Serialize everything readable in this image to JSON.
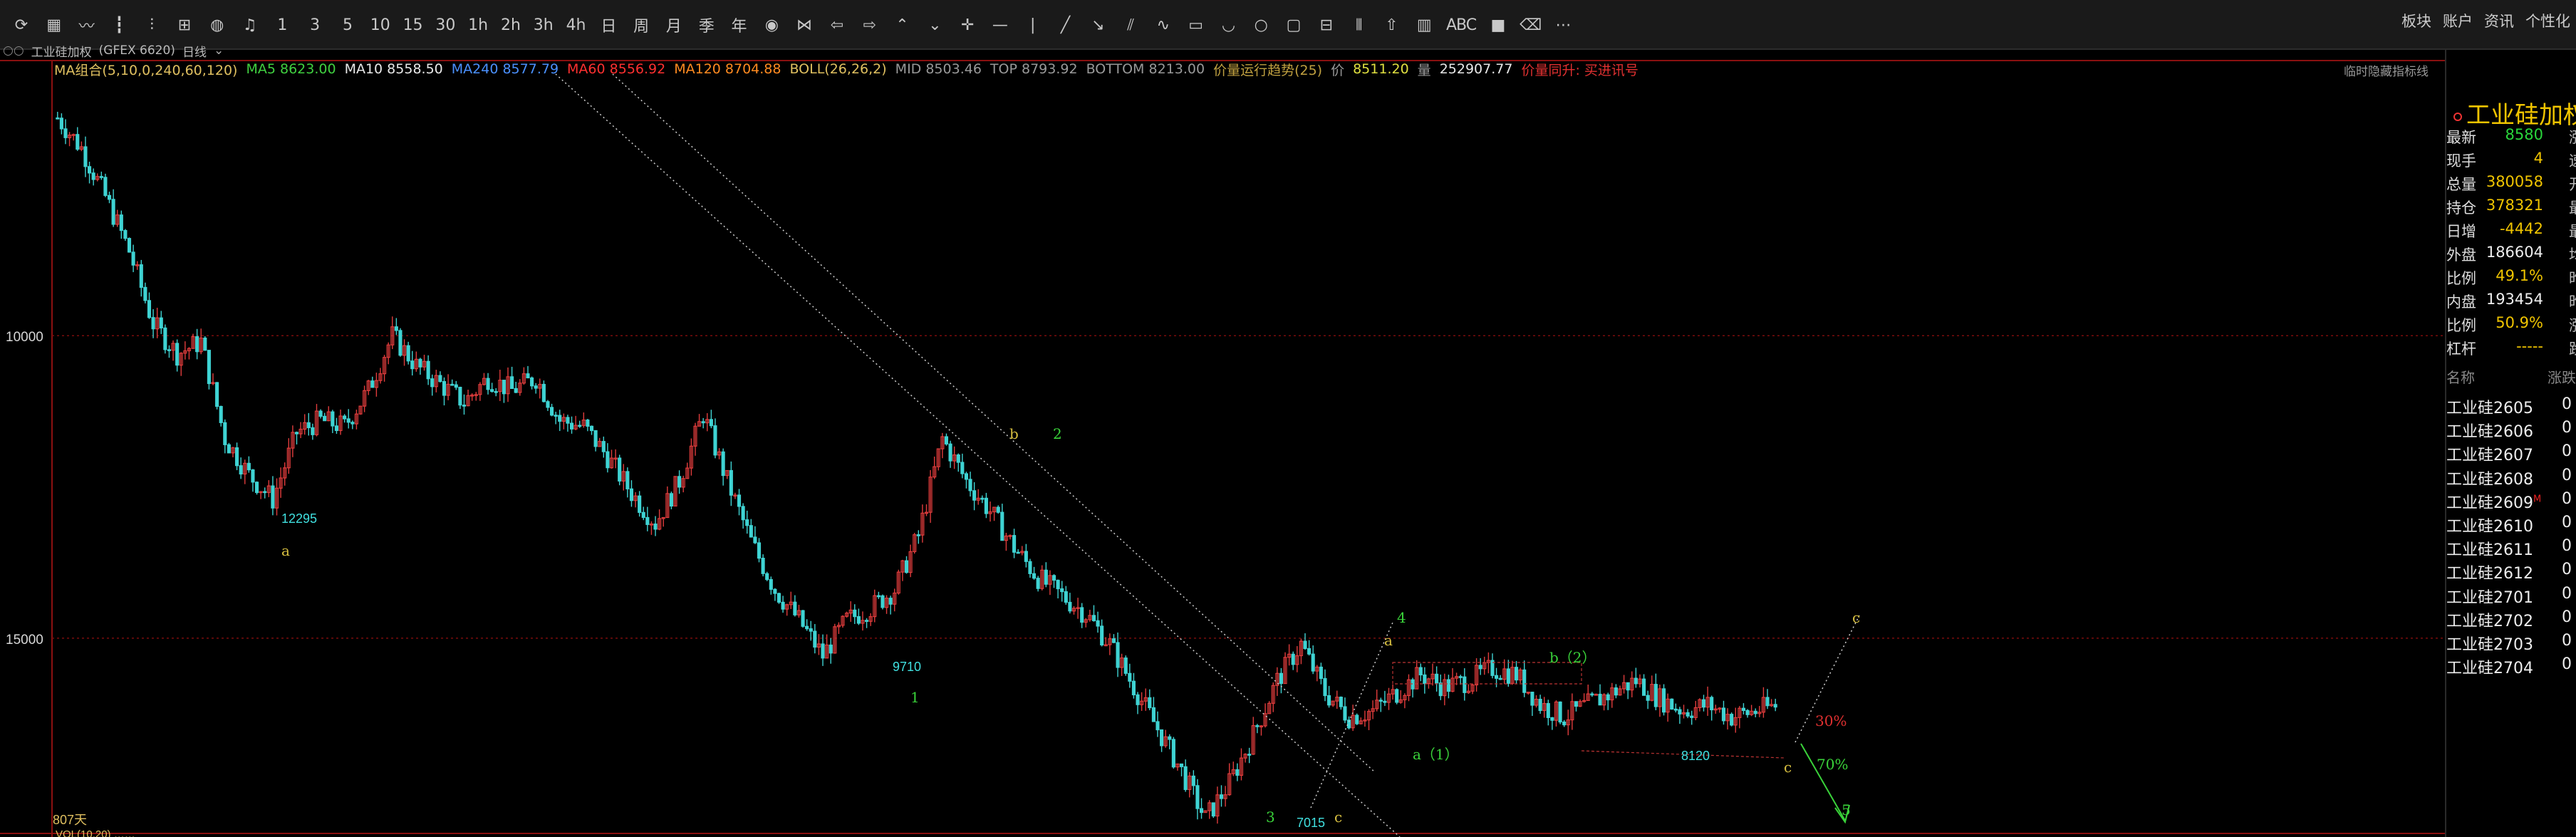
{
  "toolbar": {
    "tools": [
      {
        "name": "refresh-icon",
        "glyph": "⟳"
      },
      {
        "name": "table-icon",
        "glyph": "▦"
      },
      {
        "name": "line-chart-icon",
        "glyph": "〰"
      },
      {
        "name": "candlestick-icon",
        "glyph": "┇"
      },
      {
        "name": "bars-icon",
        "glyph": "⫶"
      },
      {
        "name": "grid-icon",
        "glyph": "⊞"
      },
      {
        "name": "globe-icon",
        "glyph": "◍"
      },
      {
        "name": "bell-icon",
        "glyph": "♫"
      },
      {
        "name": "period-1",
        "glyph": "1"
      },
      {
        "name": "period-3",
        "glyph": "3"
      },
      {
        "name": "period-5",
        "glyph": "5"
      },
      {
        "name": "period-10",
        "glyph": "10"
      },
      {
        "name": "period-15",
        "glyph": "15"
      },
      {
        "name": "period-30",
        "glyph": "30"
      },
      {
        "name": "period-1h",
        "glyph": "1h"
      },
      {
        "name": "period-2h",
        "glyph": "2h"
      },
      {
        "name": "period-3h",
        "glyph": "3h"
      },
      {
        "name": "period-4h",
        "glyph": "4h"
      },
      {
        "name": "period-day",
        "glyph": "日"
      },
      {
        "name": "period-week",
        "glyph": "周"
      },
      {
        "name": "period-month",
        "glyph": "月"
      },
      {
        "name": "period-season",
        "glyph": "季"
      },
      {
        "name": "period-year",
        "glyph": "年"
      },
      {
        "name": "eye-icon",
        "glyph": "◉"
      },
      {
        "name": "bowtie-icon",
        "glyph": "⋈"
      },
      {
        "name": "arrow-left-icon",
        "glyph": "⇦"
      },
      {
        "name": "arrow-right-icon",
        "glyph": "⇨"
      },
      {
        "name": "chevrons-up-icon",
        "glyph": "⌃"
      },
      {
        "name": "chevrons-down-icon",
        "glyph": "⌄"
      },
      {
        "name": "crosshair-icon",
        "glyph": "✛"
      },
      {
        "name": "horizontal-line-icon",
        "glyph": "—"
      },
      {
        "name": "vertical-line-icon",
        "glyph": "|"
      },
      {
        "name": "trend-line-icon",
        "glyph": "╱"
      },
      {
        "name": "ray-icon",
        "glyph": "↘"
      },
      {
        "name": "parallel-line-icon",
        "glyph": "⫽"
      },
      {
        "name": "wave-icon",
        "glyph": "∿"
      },
      {
        "name": "rectangle-icon",
        "glyph": "▭"
      },
      {
        "name": "arc-icon",
        "glyph": "◡"
      },
      {
        "name": "circle-icon",
        "glyph": "○"
      },
      {
        "name": "square-icon",
        "glyph": "▢"
      },
      {
        "name": "fibonacci-icon",
        "glyph": "⊟"
      },
      {
        "name": "columns-icon",
        "glyph": "⦀"
      },
      {
        "name": "up-arrow-icon",
        "glyph": "⇧"
      },
      {
        "name": "bar-chart-icon",
        "glyph": "▥"
      },
      {
        "name": "text-tool",
        "glyph": "ABC"
      },
      {
        "name": "fill-icon",
        "glyph": "■"
      },
      {
        "name": "eraser-icon",
        "glyph": "⌫"
      },
      {
        "name": "more-icon",
        "glyph": "⋯"
      }
    ],
    "menu": [
      "板块",
      "账户",
      "资讯",
      "个性化"
    ]
  },
  "symbol_bar": {
    "prefix": "○○",
    "symbol": "工业硅加权",
    "exchange": "(GFEX 6620)",
    "period": "日线"
  },
  "ma_line": [
    {
      "text": "MA组合(5,10,0,240,60,120)",
      "color": "#e0c060"
    },
    {
      "text": "MA5 8623.00",
      "color": "#40d040"
    },
    {
      "text": "MA10 8558.50",
      "color": "#e8e8e8"
    },
    {
      "text": "MA240 8577.79",
      "color": "#4a90ff"
    },
    {
      "text": "MA60 8556.92",
      "color": "#ff3030"
    },
    {
      "text": "MA120 8704.88",
      "color": "#ff8a20"
    },
    {
      "text": "BOLL(26,26,2)",
      "color": "#e0c060"
    },
    {
      "text": "MID 8503.46",
      "color": "#999999"
    },
    {
      "text": "TOP 8793.92",
      "color": "#999999"
    },
    {
      "text": "BOTTOM 8213.00",
      "color": "#999999"
    },
    {
      "text": "价量运行趋势(25)",
      "color": "#c0a040"
    },
    {
      "text": "价",
      "color": "#999999"
    },
    {
      "text": "8511.20",
      "color": "#e0e040"
    },
    {
      "text": "量",
      "color": "#999999"
    },
    {
      "text": "252907.77",
      "color": "#e8e8e8"
    },
    {
      "text": "价量同升: 买进讯号",
      "color": "#e03030"
    }
  ],
  "right_note": "临时隐藏指标线",
  "chart": {
    "price_labels": [
      "15000",
      "10000"
    ],
    "bottom_label": "807天",
    "bottom_indicator": "VOL(10,20)  ……",
    "point_labels": [
      "12295",
      "9710",
      "7015",
      "8120"
    ],
    "wave_labels": [
      "a",
      "1",
      "b",
      "2",
      "3",
      "c",
      "4",
      "a",
      "a（1）",
      "b（2）",
      "c",
      "c",
      "5",
      "30%",
      "70%"
    ]
  },
  "chart_data": {
    "type": "candlestick",
    "title": "",
    "xlabel": "",
    "ylabel": "",
    "ylim": [
      6960,
      19560
    ],
    "y_ticks": [
      10000,
      15000
    ],
    "approx_series_close": [
      18600,
      18100,
      17300,
      16400,
      15200,
      14700,
      14900,
      13300,
      12700,
      12295,
      13400,
      13600,
      13500,
      14100,
      15000,
      14500,
      14200,
      13900,
      14300,
      14100,
      14300,
      13600,
      13500,
      13000,
      12400,
      11900,
      12600,
      13700,
      12600,
      11600,
      10800,
      10300,
      9710,
      10300,
      10500,
      10800,
      11700,
      13300,
      12600,
      12100,
      11500,
      11000,
      10700,
      10400,
      9900,
      9200,
      8500,
      7800,
      7015,
      7600,
      8400,
      9300,
      9900,
      9100,
      8700,
      8800,
      9100,
      9400,
      9200,
      9300,
      9500,
      9400,
      8900,
      8700,
      8900,
      9100,
      9300,
      9000,
      8800,
      8900,
      8700,
      8800,
      8900
    ]
  },
  "panel": {
    "title": "工业硅加权",
    "stats": [
      {
        "label": "最新",
        "value": "8580",
        "color": "green",
        "cut": "涨"
      },
      {
        "label": "现手",
        "value": "4",
        "color": "yellow",
        "cut": "速"
      },
      {
        "label": "总量",
        "value": "380058",
        "color": "yellow",
        "cut": "开"
      },
      {
        "label": "持仓",
        "value": "378321",
        "color": "yellow",
        "cut": "最"
      },
      {
        "label": "日增",
        "value": "-4442",
        "color": "yellow",
        "cut": "最"
      },
      {
        "label": "外盘",
        "value": "186604",
        "color": "white",
        "cut": "均"
      },
      {
        "label": "比例",
        "value": "49.1%",
        "color": "yellow",
        "cut": "昨"
      },
      {
        "label": "内盘",
        "value": "193454",
        "color": "white",
        "cut": "昨"
      },
      {
        "label": "比例",
        "value": "50.9%",
        "color": "yellow",
        "cut": "涨"
      },
      {
        "label": "杠杆",
        "value": "-----",
        "color": "yellow",
        "cut": "跌"
      }
    ],
    "list_head": {
      "name": "名称",
      "change": "涨跌"
    },
    "contracts": [
      {
        "name": "工业硅2605",
        "change": "0",
        "mark": ""
      },
      {
        "name": "工业硅2606",
        "change": "0",
        "mark": ""
      },
      {
        "name": "工业硅2607",
        "change": "0",
        "mark": ""
      },
      {
        "name": "工业硅2608",
        "change": "0",
        "mark": ""
      },
      {
        "name": "工业硅2609",
        "change": "0",
        "mark": "M"
      },
      {
        "name": "工业硅2610",
        "change": "0",
        "mark": ""
      },
      {
        "name": "工业硅2611",
        "change": "0",
        "mark": ""
      },
      {
        "name": "工业硅2612",
        "change": "0",
        "mark": ""
      },
      {
        "name": "工业硅2701",
        "change": "0",
        "mark": ""
      },
      {
        "name": "工业硅2702",
        "change": "0",
        "mark": ""
      },
      {
        "name": "工业硅2703",
        "change": "0",
        "mark": ""
      },
      {
        "name": "工业硅2704",
        "change": "0",
        "mark": ""
      }
    ]
  }
}
